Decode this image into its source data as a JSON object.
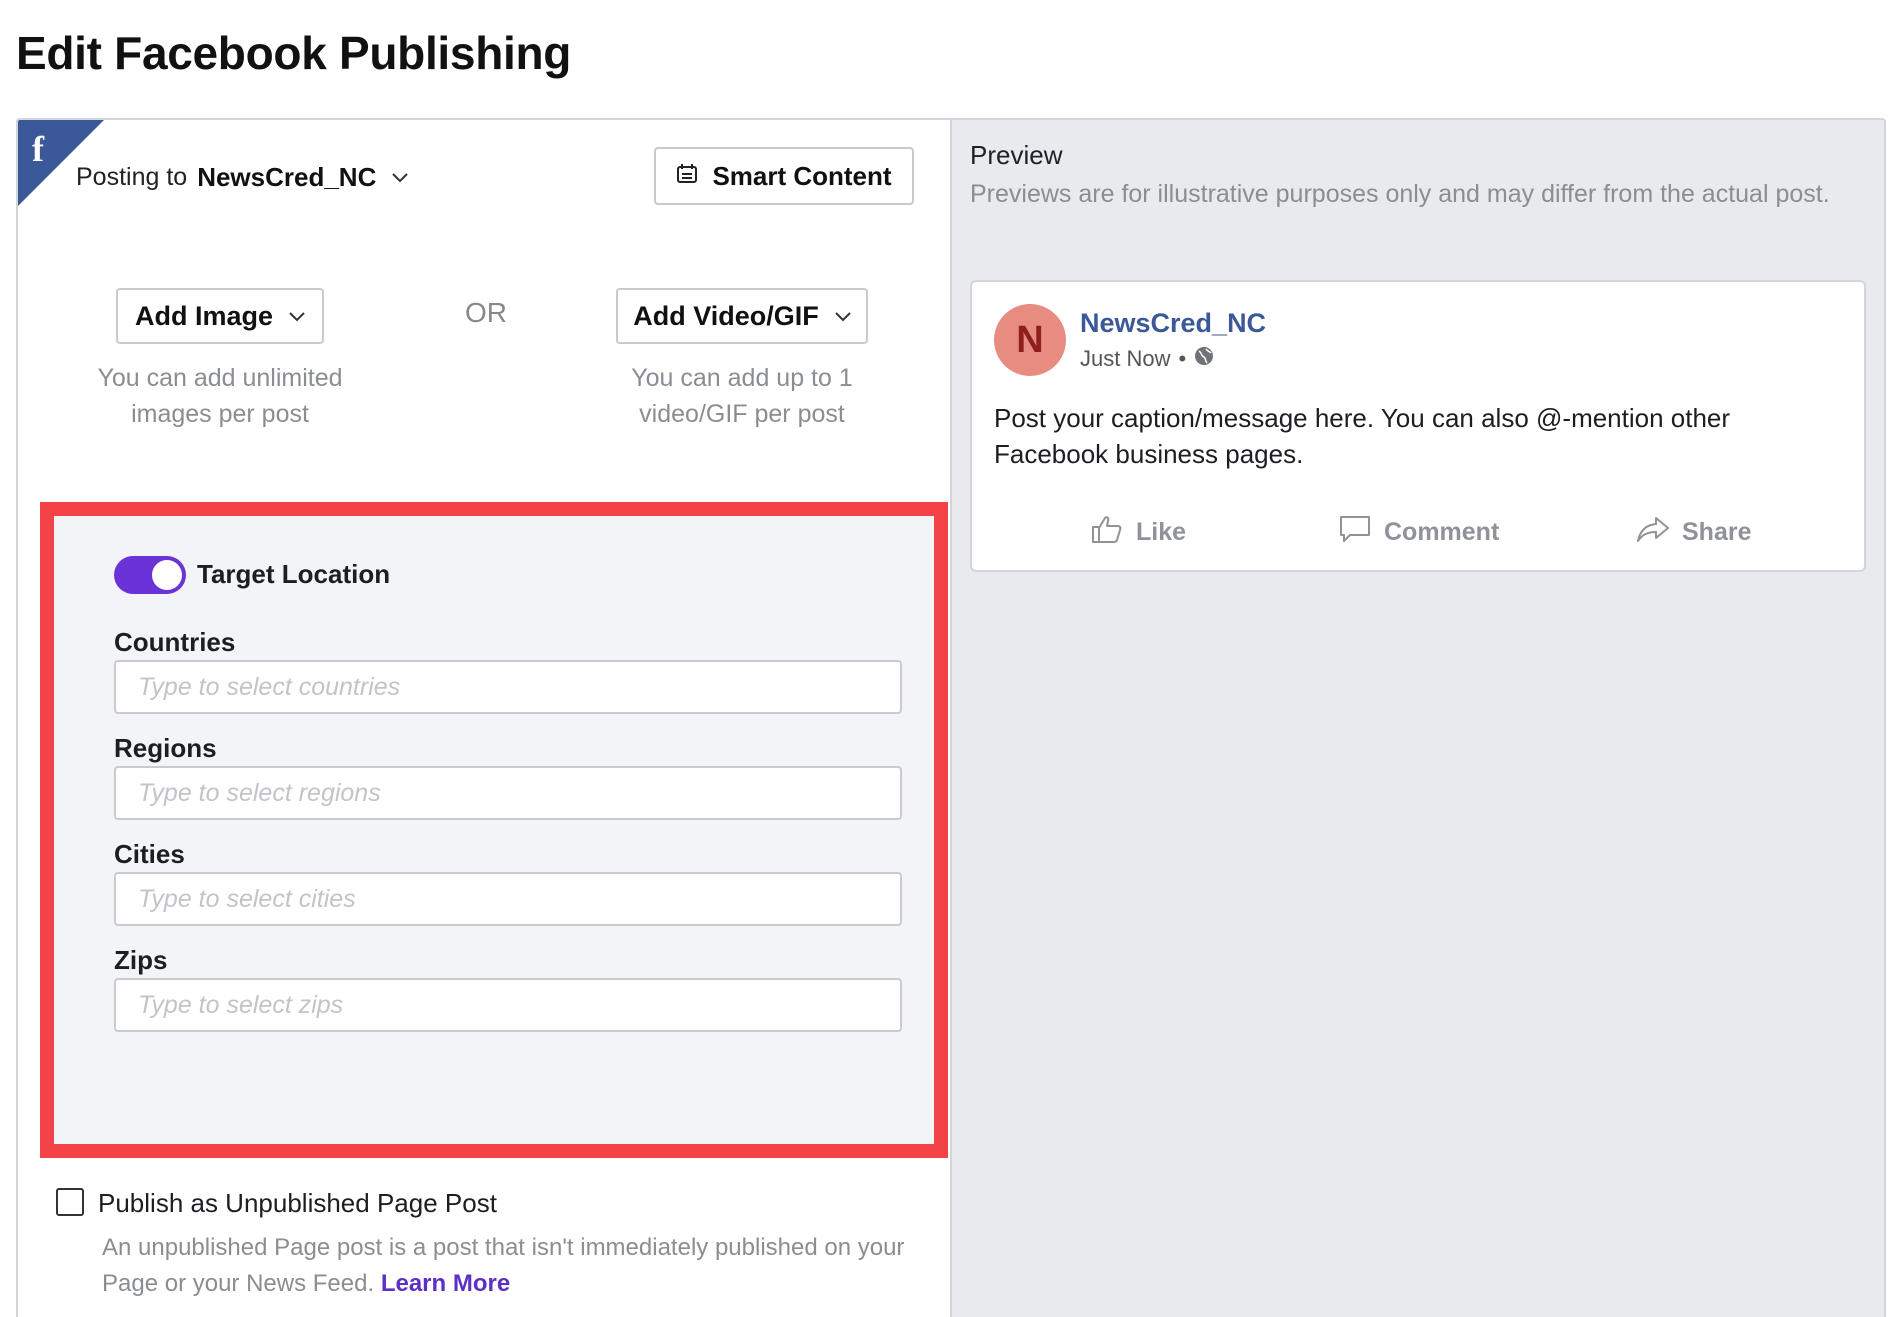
{
  "page": {
    "title": "Edit Facebook Publishing"
  },
  "posting": {
    "prefix": "Posting to",
    "account": "NewsCred_NC",
    "chevron": "chevron-down-icon"
  },
  "smart_content": {
    "label": "Smart Content",
    "icon": "smart-content-icon"
  },
  "media": {
    "add_image": {
      "label": "Add Image",
      "note": "You can add unlimited images per post"
    },
    "or_label": "OR",
    "add_video": {
      "label": "Add Video/GIF",
      "note": "You can add up to 1 video/GIF per post"
    }
  },
  "target_location": {
    "toggle_label": "Target Location",
    "enabled": true,
    "accent_color": "#6b33d7",
    "highlight_color": "#f44346",
    "fields": {
      "countries": {
        "label": "Countries",
        "placeholder": "Type to select countries"
      },
      "regions": {
        "label": "Regions",
        "placeholder": "Type to select regions"
      },
      "cities": {
        "label": "Cities",
        "placeholder": "Type to select cities"
      },
      "zips": {
        "label": "Zips",
        "placeholder": "Type to select zips"
      }
    }
  },
  "unpublished": {
    "label": "Publish as Unpublished Page Post",
    "checked": false,
    "description": "An unpublished Page post is a post that isn't immediately published on your Page or your News Feed.",
    "learn_more": "Learn More"
  },
  "preview": {
    "title": "Preview",
    "note": "Previews are for illustrative purposes only and may differ from the actual post.",
    "card": {
      "avatar_letter": "N",
      "name": "NewsCred_NC",
      "time": "Just Now",
      "separator": "•",
      "text": "Post your caption/message here. You can also @-mention other Facebook business pages.",
      "actions": {
        "like": "Like",
        "comment": "Comment",
        "share": "Share"
      }
    }
  }
}
